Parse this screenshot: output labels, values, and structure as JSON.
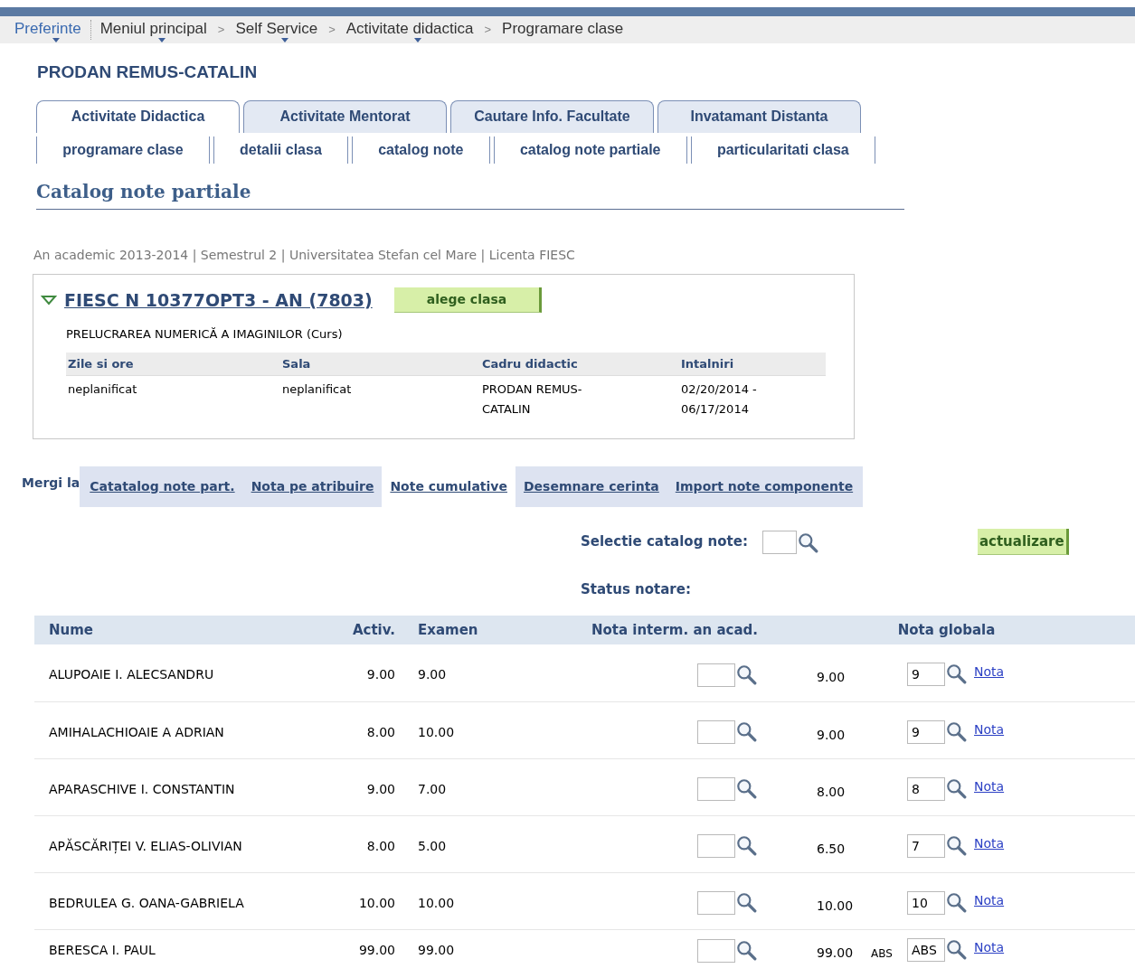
{
  "breadcrumb": [
    {
      "label": "Preferinte",
      "has_menu": true,
      "link": true
    },
    {
      "label": "Meniul principal",
      "has_menu": true,
      "link": false
    },
    {
      "label": "Self Service",
      "has_menu": true,
      "link": false,
      "separator": ">"
    },
    {
      "label": "Activitate didactica",
      "has_menu": true,
      "link": false,
      "separator": ">"
    },
    {
      "label": "Programare clase",
      "has_menu": false,
      "link": false,
      "separator": ">"
    }
  ],
  "person": "PRODAN REMUS-CATALIN",
  "tabs": [
    {
      "label": "Activitate Didactica",
      "selected": true
    },
    {
      "label": "Activitate Mentorat",
      "selected": false
    },
    {
      "label": "Cautare Info. Facultate",
      "selected": false
    },
    {
      "label": "Invatamant Distanta",
      "selected": false
    }
  ],
  "subtabs": [
    "programare clase",
    "detalii clasa",
    "catalog note",
    "catalog note partiale",
    "particularitati clasa"
  ],
  "page_title": "Catalog note partiale",
  "context": "An academic 2013-2014 | Semestrul 2 | Universitatea Stefan cel Mare | Licenta FIESC",
  "class_box": {
    "expanded": true,
    "class_link": "FIESC  N 10377OPT3 - AN (7803)",
    "button": "alege clasa",
    "course": "PRELUCRAREA NUMERICĂ A IMAGINILOR (Curs)",
    "columns": [
      "Zile si ore",
      "Sala",
      "Cadru didactic",
      "Intalniri"
    ],
    "row": [
      "neplanificat",
      "neplanificat",
      "PRODAN REMUS-CATALIN",
      "02/20/2014 - 06/17/2014"
    ]
  },
  "goto": {
    "label": "Mergi la",
    "links": [
      {
        "label": "Catatalog note part.",
        "selected": false
      },
      {
        "label": "Nota pe atribuire",
        "selected": false
      },
      {
        "label": "Note cumulative",
        "selected": true
      },
      {
        "label": "Desemnare cerinta",
        "selected": false
      },
      {
        "label": "Import note componente",
        "selected": false
      }
    ]
  },
  "selection": {
    "label": "Selectie catalog note:",
    "button": "actualizare",
    "status_label": "Status notare:"
  },
  "table": {
    "columns": [
      "Nume",
      "Activ.",
      "Examen",
      "Nota interm. an acad.",
      "Nota globala"
    ],
    "rows": [
      {
        "name": "ALUPOAIE I. ALECSANDRU",
        "activ": "9.00",
        "examen": "9.00",
        "computed": "9.00",
        "global": "9",
        "link": "Nota"
      },
      {
        "name": "AMIHALACHIOAIE A ADRIAN",
        "activ": "8.00",
        "examen": "10.00",
        "computed": "9.00",
        "global": "9",
        "link": "Nota"
      },
      {
        "name": "APARASCHIVE I. CONSTANTIN",
        "activ": "9.00",
        "examen": "7.00",
        "computed": "8.00",
        "global": "8",
        "link": "Nota"
      },
      {
        "name": "APĂSCĂRIȚEI V. ELIAS-OLIVIAN",
        "activ": "8.00",
        "examen": "5.00",
        "computed": "6.50",
        "global": "7",
        "link": "Nota"
      },
      {
        "name": "BEDRULEA G. OANA-GABRIELA",
        "activ": "10.00",
        "examen": "10.00",
        "computed": "10.00",
        "global": "10",
        "link": "Nota"
      },
      {
        "name": "BERESCA I. PAUL",
        "activ": "99.00",
        "examen": "99.00",
        "computed": "99.00",
        "flag": "ABS",
        "global": "ABS",
        "link": "Nota"
      }
    ]
  }
}
